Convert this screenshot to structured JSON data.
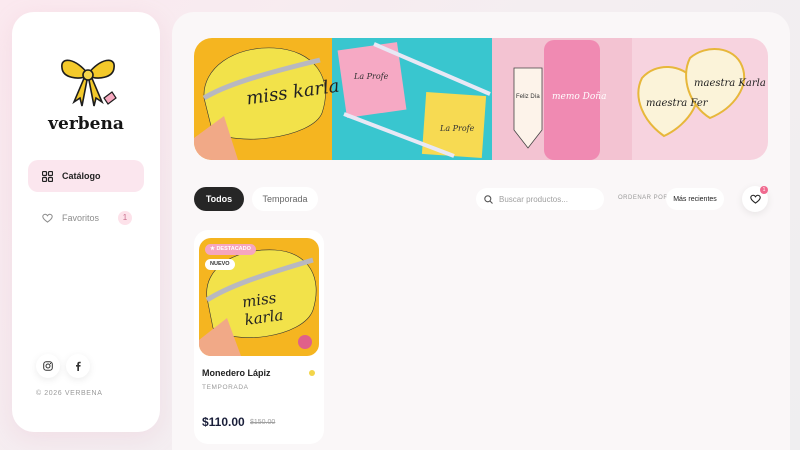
{
  "brand": {
    "name": "verbena",
    "logo": "bow-icon"
  },
  "sidebar": {
    "items": [
      {
        "label": "Catálogo",
        "icon": "grid-icon",
        "active": true
      },
      {
        "label": "Favoritos",
        "icon": "heart-icon",
        "count": "1"
      }
    ],
    "social": [
      "instagram-icon",
      "facebook-icon"
    ],
    "copyright": "© 2026 VERBENA"
  },
  "banner": {
    "texts": [
      "miss karla",
      "La Profe",
      "La Profe",
      "Feliz Día",
      "memo Doña",
      "maestra Karla",
      "maestra Fer"
    ]
  },
  "filters": {
    "tabs": [
      {
        "label": "Todos",
        "active": true
      },
      {
        "label": "Temporada",
        "active": false
      }
    ],
    "search_placeholder": "Buscar productos...",
    "sort_label": "ORDENAR POR:",
    "sort_value": "Más recientes",
    "favorites_count": "1"
  },
  "products": [
    {
      "name": "Monedero Lápiz",
      "category": "TEMPORADA",
      "price": "$110.00",
      "old_price": "$150.00",
      "badges": [
        "★ DESTACADO",
        "NUEVO"
      ],
      "image_text": "miss karla"
    }
  ],
  "colors": {
    "accent": "#fbe6ee",
    "dark": "#262626",
    "price": "#1a1f3a",
    "dot": "#f3d54a"
  }
}
